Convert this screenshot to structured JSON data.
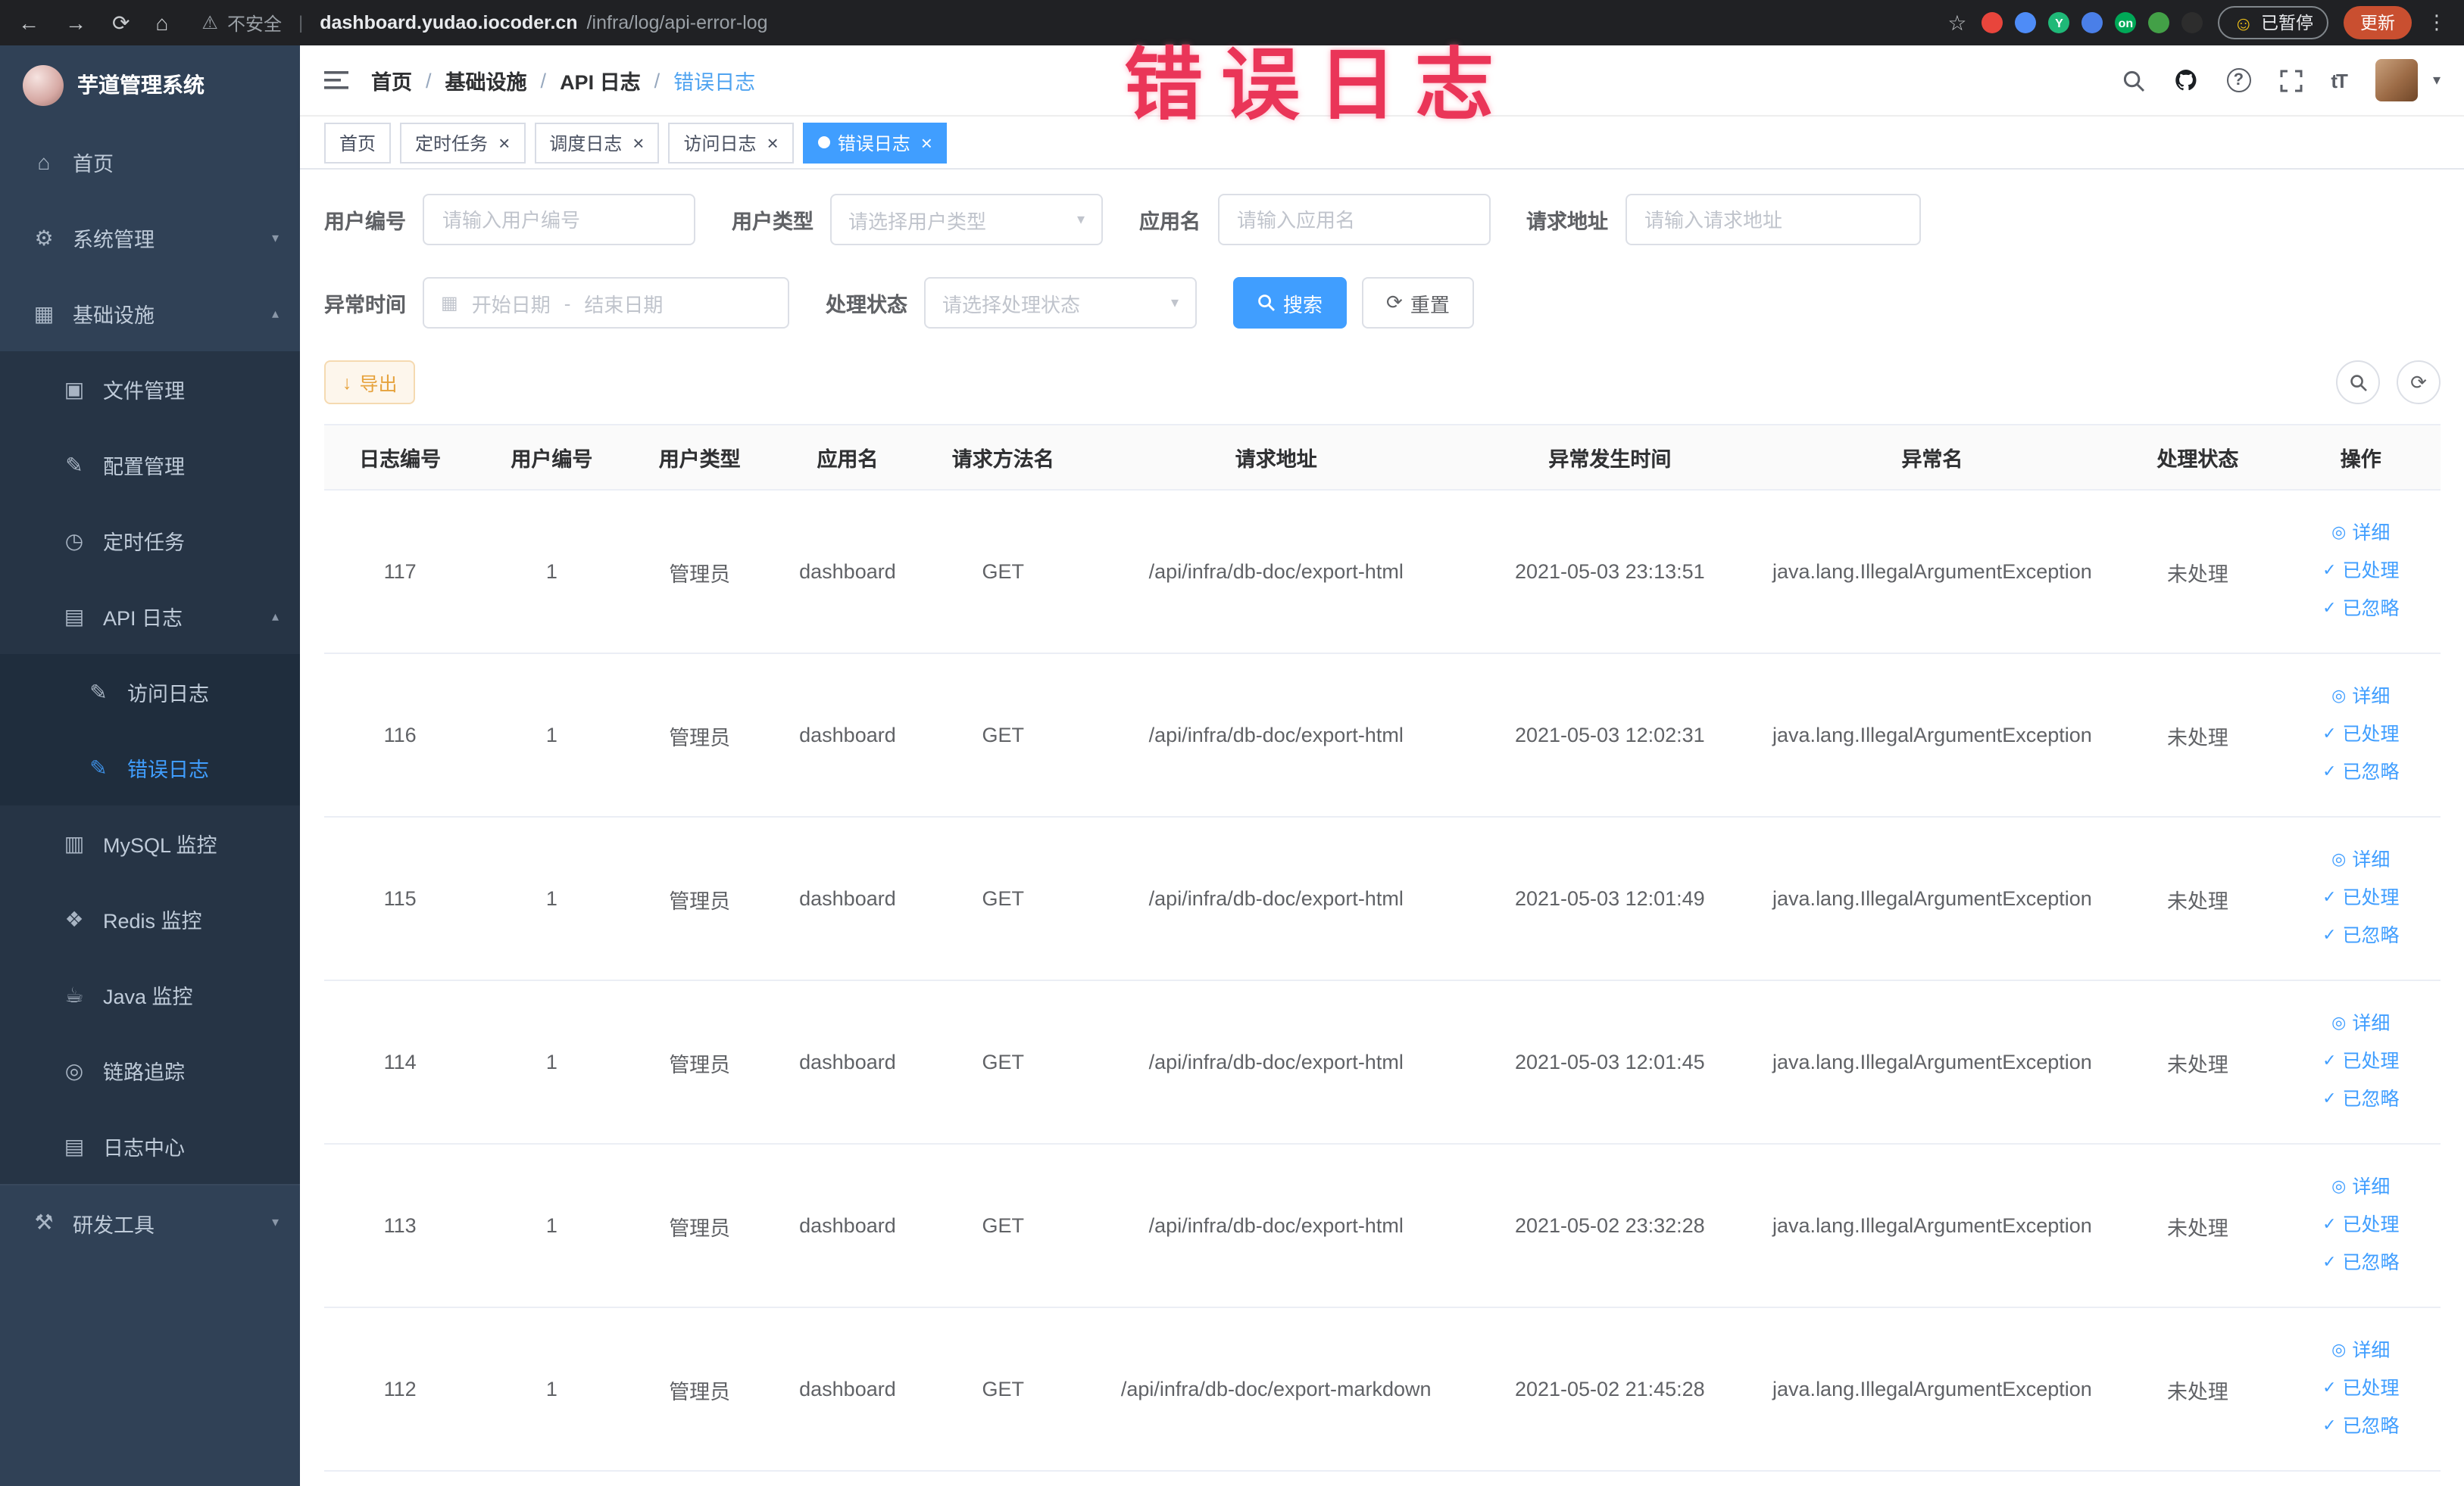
{
  "browser": {
    "security_label": "不安全",
    "url_domain": "dashboard.yudao.iocoder.cn",
    "url_path": "/infra/log/api-error-log",
    "paused_button": "已暂停",
    "update_button": "更新",
    "extensions": [
      {
        "name": "ext-record-icon",
        "color": "#e8453c",
        "text": ""
      },
      {
        "name": "ext-drop-icon",
        "color": "#4e8cf7",
        "text": ""
      },
      {
        "name": "ext-y-icon",
        "color": "#1fb978",
        "text": "Y"
      },
      {
        "name": "ext-grid-icon",
        "color": "#4a7fe8",
        "text": ""
      },
      {
        "name": "ext-on-icon",
        "color": "#00a857",
        "text": "on"
      },
      {
        "name": "ext-leaf-icon",
        "color": "#43a047",
        "text": ""
      },
      {
        "name": "ext-paw-icon",
        "color": "#2d2d2d",
        "text": ""
      }
    ]
  },
  "overlay": {
    "caption": "错误日志"
  },
  "sidebar": {
    "logo_title": "芋道管理系统",
    "items": [
      {
        "key": "home",
        "label": "首页",
        "icon": "home",
        "level": 1
      },
      {
        "key": "system",
        "label": "系统管理",
        "icon": "gear",
        "level": 1,
        "chevron": "down"
      },
      {
        "key": "infra",
        "label": "基础设施",
        "icon": "grid",
        "level": 1,
        "chevron": "up"
      },
      {
        "key": "file",
        "label": "文件管理",
        "icon": "folder",
        "level": 2
      },
      {
        "key": "config",
        "label": "配置管理",
        "icon": "config",
        "level": 2
      },
      {
        "key": "job",
        "label": "定时任务",
        "icon": "clock",
        "level": 2
      },
      {
        "key": "api-log",
        "label": "API 日志",
        "icon": "log",
        "level": 2,
        "chevron": "up"
      },
      {
        "key": "access-log",
        "label": "访问日志",
        "icon": "doc",
        "level": 3
      },
      {
        "key": "error-log",
        "label": "错误日志",
        "icon": "doc",
        "level": 3,
        "active": true
      },
      {
        "key": "mysql",
        "label": "MySQL 监控",
        "icon": "db",
        "level": 2
      },
      {
        "key": "redis",
        "label": "Redis 监控",
        "icon": "redis",
        "level": 2
      },
      {
        "key": "java",
        "label": "Java 监控",
        "icon": "java",
        "level": 2
      },
      {
        "key": "trace",
        "label": "链路追踪",
        "icon": "trace",
        "level": 2
      },
      {
        "key": "log-center",
        "label": "日志中心",
        "icon": "log",
        "level": 2
      },
      {
        "key": "dev-tools",
        "label": "研发工具",
        "icon": "tools",
        "level": 1,
        "chevron": "down",
        "section": true
      }
    ]
  },
  "header": {
    "breadcrumb": [
      "首页",
      "基础设施",
      "API 日志",
      "错误日志"
    ]
  },
  "tabs": [
    {
      "key": "home",
      "label": "首页",
      "closable": false,
      "active": false
    },
    {
      "key": "job",
      "label": "定时任务",
      "closable": true,
      "active": false
    },
    {
      "key": "job-log",
      "label": "调度日志",
      "closable": true,
      "active": false
    },
    {
      "key": "access-log",
      "label": "访问日志",
      "closable": true,
      "active": false
    },
    {
      "key": "error-log",
      "label": "错误日志",
      "closable": true,
      "active": true
    }
  ],
  "filters": {
    "user_id": {
      "label": "用户编号",
      "placeholder": "请输入用户编号"
    },
    "user_type": {
      "label": "用户类型",
      "placeholder": "请选择用户类型"
    },
    "app_name": {
      "label": "应用名",
      "placeholder": "请输入应用名"
    },
    "request_url": {
      "label": "请求地址",
      "placeholder": "请输入请求地址"
    },
    "exception_time": {
      "label": "异常时间",
      "start_placeholder": "开始日期",
      "separator": "-",
      "end_placeholder": "结束日期"
    },
    "process_status": {
      "label": "处理状态",
      "placeholder": "请选择处理状态"
    },
    "search_button": "搜索",
    "reset_button": "重置"
  },
  "toolbar": {
    "export_button": "导出"
  },
  "table": {
    "columns": [
      "日志编号",
      "用户编号",
      "用户类型",
      "应用名",
      "请求方法名",
      "请求地址",
      "异常发生时间",
      "异常名",
      "处理状态",
      "操作"
    ],
    "actions": [
      {
        "key": "detail",
        "label": "详细",
        "icon": "eye"
      },
      {
        "key": "processed",
        "label": "已处理",
        "icon": "check"
      },
      {
        "key": "ignored",
        "label": "已忽略",
        "icon": "check"
      }
    ],
    "rows": [
      {
        "id": "117",
        "user_id": "1",
        "user_type": "管理员",
        "app": "dashboard",
        "method": "GET",
        "url": "/api/infra/db-doc/export-html",
        "time": "2021-05-03 23:13:51",
        "exception": "java.lang.IllegalArgumentException",
        "status": "未处理"
      },
      {
        "id": "116",
        "user_id": "1",
        "user_type": "管理员",
        "app": "dashboard",
        "method": "GET",
        "url": "/api/infra/db-doc/export-html",
        "time": "2021-05-03 12:02:31",
        "exception": "java.lang.IllegalArgumentException",
        "status": "未处理"
      },
      {
        "id": "115",
        "user_id": "1",
        "user_type": "管理员",
        "app": "dashboard",
        "method": "GET",
        "url": "/api/infra/db-doc/export-html",
        "time": "2021-05-03 12:01:49",
        "exception": "java.lang.IllegalArgumentException",
        "status": "未处理"
      },
      {
        "id": "114",
        "user_id": "1",
        "user_type": "管理员",
        "app": "dashboard",
        "method": "GET",
        "url": "/api/infra/db-doc/export-html",
        "time": "2021-05-03 12:01:45",
        "exception": "java.lang.IllegalArgumentException",
        "status": "未处理"
      },
      {
        "id": "113",
        "user_id": "1",
        "user_type": "管理员",
        "app": "dashboard",
        "method": "GET",
        "url": "/api/infra/db-doc/export-html",
        "time": "2021-05-02 23:32:28",
        "exception": "java.lang.IllegalArgumentException",
        "status": "未处理"
      },
      {
        "id": "112",
        "user_id": "1",
        "user_type": "管理员",
        "app": "dashboard",
        "method": "GET",
        "url": "/api/infra/db-doc/export-markdown",
        "time": "2021-05-02 21:45:28",
        "exception": "java.lang.IllegalArgumentException",
        "status": "未处理"
      }
    ]
  }
}
